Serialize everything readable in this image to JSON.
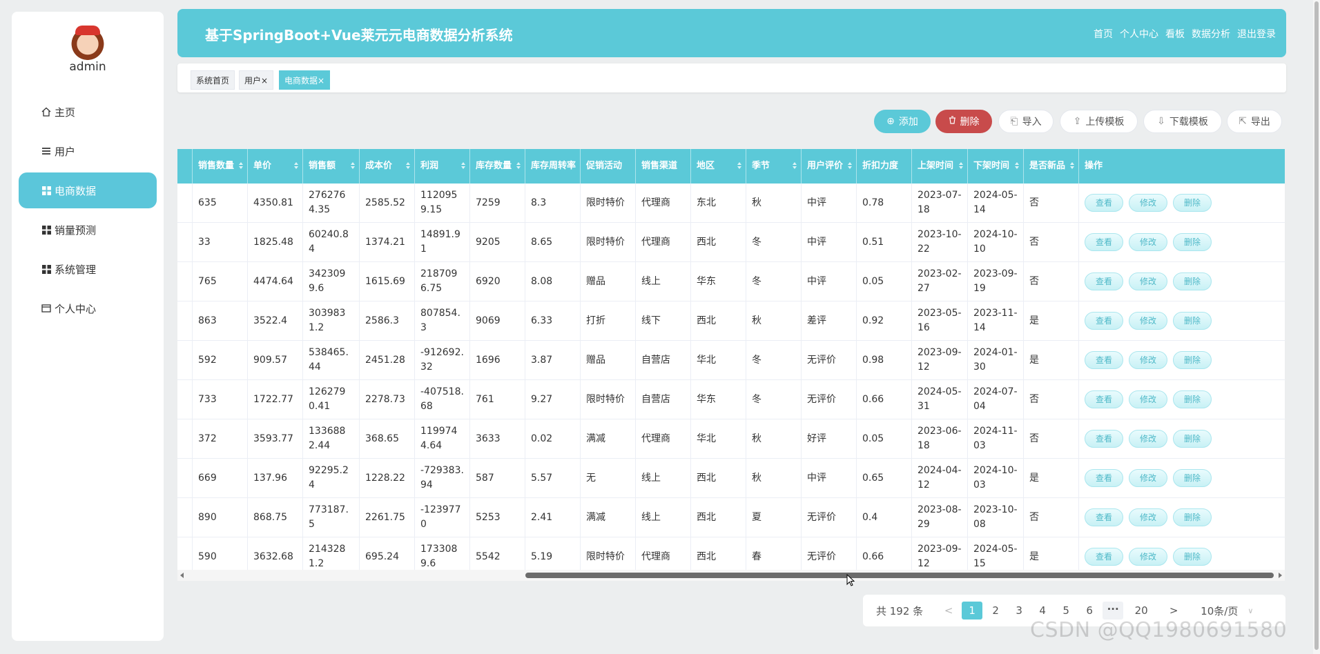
{
  "sidebar": {
    "username": "admin",
    "menu": [
      {
        "label": "主页",
        "icon": "home-icon"
      },
      {
        "label": "用户",
        "icon": "list-icon"
      },
      {
        "label": "电商数据",
        "icon": "grid-icon",
        "active": true
      },
      {
        "label": "销量预测",
        "icon": "grid-icon"
      },
      {
        "label": "系统管理",
        "icon": "grid-icon"
      },
      {
        "label": "个人中心",
        "icon": "card-icon"
      }
    ]
  },
  "header": {
    "title": "基于SpringBoot+Vue莱元元电商数据分析系统",
    "nav": [
      "首页",
      "个人中心",
      "看板",
      "数据分析",
      "退出登录"
    ]
  },
  "tabs": [
    {
      "label": "系统首页",
      "closable": false
    },
    {
      "label": "用户×",
      "closable": true
    },
    {
      "label": "电商数据×",
      "closable": true,
      "active": true
    }
  ],
  "toolbar": {
    "add": "添加",
    "delete": "删除",
    "import": "导入",
    "upload_template": "上传模板",
    "download_template": "下载模板",
    "export": "导出"
  },
  "table": {
    "columns": [
      "销售数量",
      "单价",
      "销售额",
      "成本价",
      "利润",
      "库存数量",
      "库存周转率",
      "促销活动",
      "销售渠道",
      "地区",
      "季节",
      "用户评价",
      "折扣力度",
      "上架时间",
      "下架时间",
      "是否新品",
      "操作"
    ],
    "row_actions": {
      "view": "查看",
      "edit": "修改",
      "delete": "删除"
    },
    "rows": [
      [
        "635",
        "4350.81",
        "2762764.35",
        "2585.52",
        "1120959.15",
        "7259",
        "8.3",
        "限时特价",
        "代理商",
        "东北",
        "秋",
        "中评",
        "0.78",
        "2023-07-18",
        "2024-05-14",
        "否"
      ],
      [
        "33",
        "1825.48",
        "60240.84",
        "1374.21",
        "14891.91",
        "9205",
        "8.65",
        "限时特价",
        "代理商",
        "西北",
        "冬",
        "中评",
        "0.51",
        "2023-10-22",
        "2024-10-10",
        "否"
      ],
      [
        "765",
        "4474.64",
        "3423099.6",
        "1615.69",
        "2187096.75",
        "6920",
        "8.08",
        "赠品",
        "线上",
        "华东",
        "冬",
        "中评",
        "0.05",
        "2023-02-27",
        "2023-09-19",
        "否"
      ],
      [
        "863",
        "3522.4",
        "3039831.2",
        "2586.3",
        "807854.3",
        "9069",
        "6.33",
        "打折",
        "线下",
        "西北",
        "秋",
        "差评",
        "0.92",
        "2023-05-16",
        "2023-11-14",
        "是"
      ],
      [
        "592",
        "909.57",
        "538465.44",
        "2451.28",
        "-912692.32",
        "1696",
        "3.87",
        "赠品",
        "自营店",
        "华北",
        "冬",
        "无评价",
        "0.98",
        "2023-09-12",
        "2024-01-30",
        "是"
      ],
      [
        "733",
        "1722.77",
        "1262790.41",
        "2278.73",
        "-407518.68",
        "761",
        "9.27",
        "限时特价",
        "自营店",
        "华东",
        "冬",
        "无评价",
        "0.66",
        "2024-05-31",
        "2024-07-04",
        "否"
      ],
      [
        "372",
        "3593.77",
        "1336882.44",
        "368.65",
        "1199744.64",
        "3633",
        "0.02",
        "满减",
        "代理商",
        "华北",
        "秋",
        "好评",
        "0.05",
        "2023-06-18",
        "2024-11-03",
        "否"
      ],
      [
        "669",
        "137.96",
        "92295.24",
        "1228.22",
        "-729383.94",
        "587",
        "5.57",
        "无",
        "线上",
        "西北",
        "秋",
        "中评",
        "0.65",
        "2024-04-12",
        "2024-10-03",
        "是"
      ],
      [
        "890",
        "868.75",
        "773187.5",
        "2261.75",
        "-1239770",
        "5253",
        "2.41",
        "满减",
        "线上",
        "西北",
        "夏",
        "无评价",
        "0.4",
        "2023-08-29",
        "2023-10-08",
        "否"
      ],
      [
        "590",
        "3632.68",
        "2143281.2",
        "695.24",
        "1733089.6",
        "5542",
        "5.19",
        "限时特价",
        "代理商",
        "西北",
        "春",
        "无评价",
        "0.66",
        "2023-09-12",
        "2024-05-15",
        "是"
      ]
    ]
  },
  "pagination": {
    "total": "共 192 条",
    "prev": "<",
    "pages": [
      "1",
      "2",
      "3",
      "4",
      "5",
      "6",
      "···",
      "20"
    ],
    "current": "1",
    "next": ">",
    "page_size": "10条/页"
  },
  "watermark": "CSDN @QQ1980691580"
}
